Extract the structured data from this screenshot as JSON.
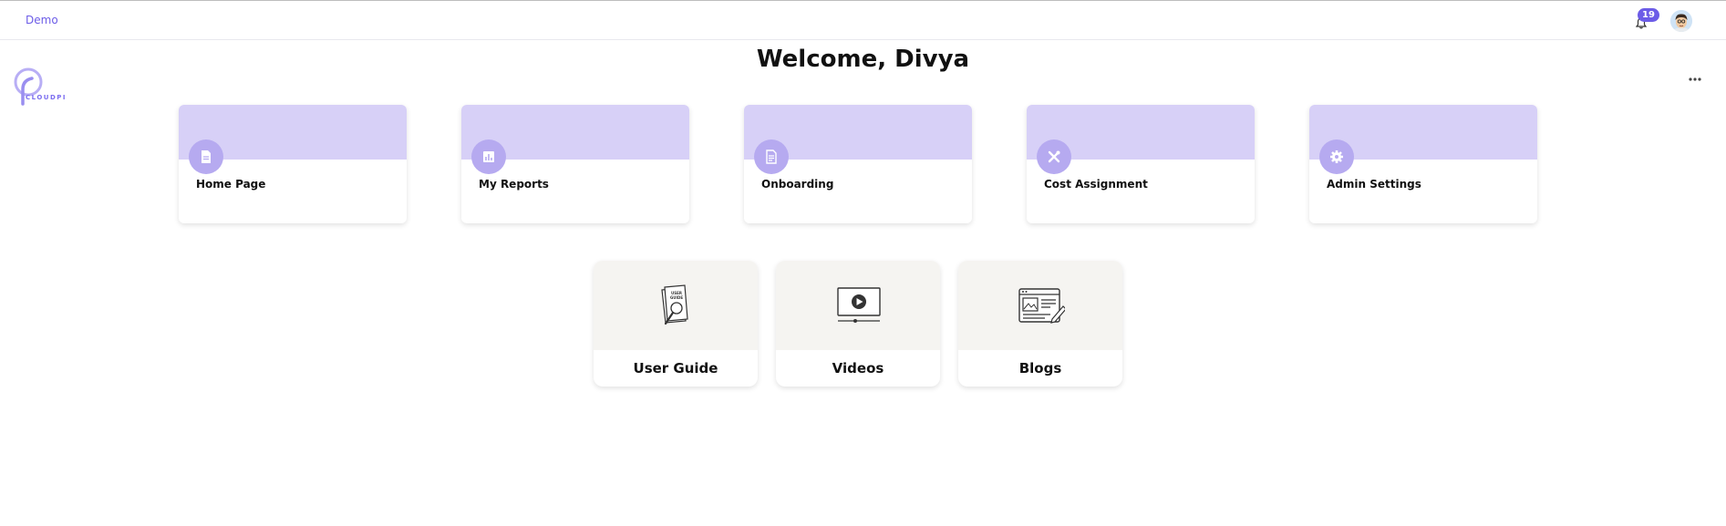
{
  "header": {
    "org_label": "Demo",
    "notification_count": "19"
  },
  "brand": {
    "logo_text": "CLOUDPI"
  },
  "welcome": "Welcome, Divya",
  "nav_cards": [
    {
      "label": "Home Page",
      "icon": "document-icon"
    },
    {
      "label": "My Reports",
      "icon": "bar-chart-icon"
    },
    {
      "label": "Onboarding",
      "icon": "doc-lines-icon"
    },
    {
      "label": "Cost Assignment",
      "icon": "tools-icon"
    },
    {
      "label": "Admin Settings",
      "icon": "gear-icon"
    }
  ],
  "resources": [
    {
      "label": "User Guide",
      "icon": "user-guide-icon",
      "art_text": "USER GUIDE"
    },
    {
      "label": "Videos",
      "icon": "video-player-icon"
    },
    {
      "label": "Blogs",
      "icon": "blog-icon"
    }
  ],
  "colors": {
    "accent": "#6c5ce7",
    "card_header": "#d7d0f7",
    "icon_circle": "#b6aaf0",
    "resource_bg": "#f5f4f1"
  }
}
